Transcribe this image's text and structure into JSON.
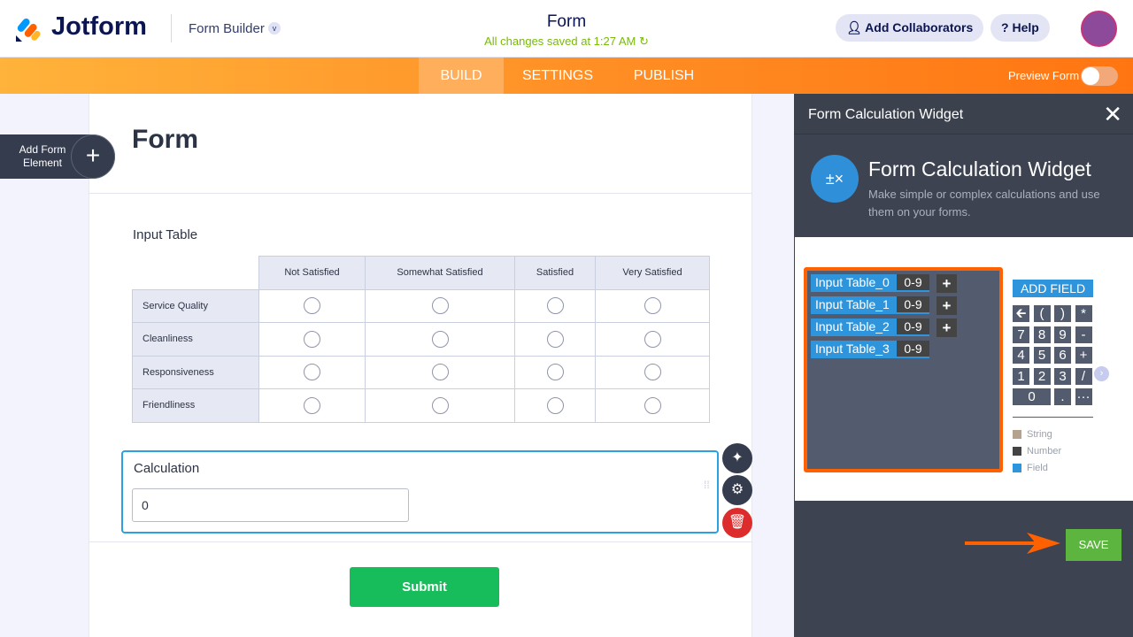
{
  "header": {
    "logo": "Jotform",
    "product": "Form Builder",
    "title": "Form",
    "saved": "All changes saved at 1:27 AM",
    "collab": "Add Collaborators",
    "help": "Help"
  },
  "nav": {
    "tabs": [
      "BUILD",
      "SETTINGS",
      "PUBLISH"
    ],
    "preview": "Preview Form"
  },
  "canvas": {
    "add_element": "Add Form Element",
    "form_title": "Form",
    "table_label": "Input Table",
    "columns": [
      "Not Satisfied",
      "Somewhat Satisfied",
      "Satisfied",
      "Very Satisfied"
    ],
    "rows": [
      "Service Quality",
      "Cleanliness",
      "Responsiveness",
      "Friendliness"
    ],
    "calc_label": "Calculation",
    "calc_value": "0",
    "submit": "Submit"
  },
  "panel": {
    "header": "Form Calculation Widget",
    "title": "Form Calculation Widget",
    "desc": "Make simple or complex calculations and use them on your forms.",
    "fields": [
      {
        "name": "Input Table_0",
        "type": "0-9"
      },
      {
        "name": "Input Table_1",
        "type": "0-9"
      },
      {
        "name": "Input Table_2",
        "type": "0-9"
      },
      {
        "name": "Input Table_3",
        "type": "0-9"
      }
    ],
    "add_field": "ADD FIELD",
    "keys": [
      "🡰",
      "(",
      ")",
      "*",
      "7",
      "8",
      "9",
      "-",
      "4",
      "5",
      "6",
      "+",
      "1",
      "2",
      "3",
      "/",
      "0",
      ".",
      "···"
    ],
    "legend": [
      {
        "label": "String",
        "color": "#b5a38f"
      },
      {
        "label": "Number",
        "color": "#444444"
      },
      {
        "label": "Field",
        "color": "#2e95dc"
      }
    ],
    "save": "SAVE"
  }
}
